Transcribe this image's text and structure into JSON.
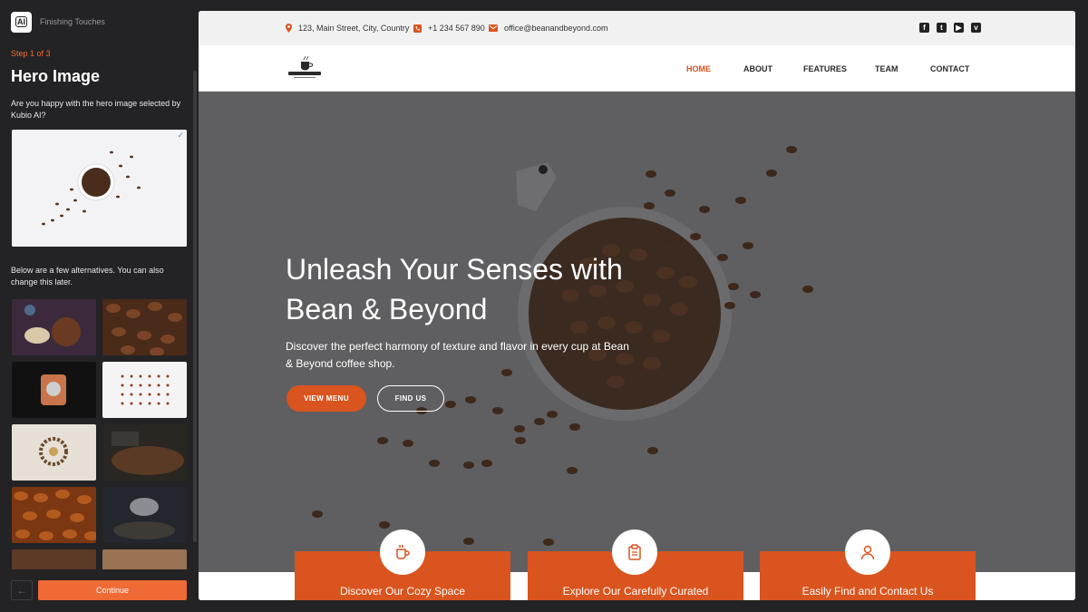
{
  "panel": {
    "app_title": "Finishing Touches",
    "logo_text": "AI",
    "step": "Step 1 of 3",
    "section_title": "Hero Image",
    "question": "Are you happy with the hero image selected by Kubio AI?",
    "alternatives_text": "Below are a few alternatives. You can also change this later.",
    "continue_label": "Continue",
    "back_icon": "arrow-left-icon",
    "check_icon": "check-icon"
  },
  "site": {
    "topbar": {
      "address": "123, Main Street, City, Country",
      "phone": "+1 234 567 890",
      "email": "office@beanandbeyond.com"
    },
    "socials": [
      "facebook-icon",
      "twitter-icon",
      "youtube-icon",
      "vimeo-icon"
    ],
    "nav": [
      "HOME",
      "ABOUT",
      "FEATURES",
      "TEAM",
      "CONTACT"
    ],
    "hero": {
      "title": "Unleash Your Senses with Bean & Beyond",
      "subtitle": "Discover the perfect harmony of texture and flavor in every cup at Bean & Beyond coffee shop.",
      "primary_button": "VIEW MENU",
      "secondary_button": "FIND US"
    },
    "cards": [
      {
        "title": "Discover Our Cozy Space",
        "icon": "coffee-cup-icon"
      },
      {
        "title": "Explore Our Carefully Curated",
        "icon": "clipboard-icon"
      },
      {
        "title": "Easily Find and Contact Us",
        "icon": "user-icon"
      }
    ]
  },
  "colors": {
    "accent": "#d9541e",
    "panel_button": "#ef6a35",
    "panel_bg": "#232325",
    "hero_overlay": "#5f5f61"
  }
}
